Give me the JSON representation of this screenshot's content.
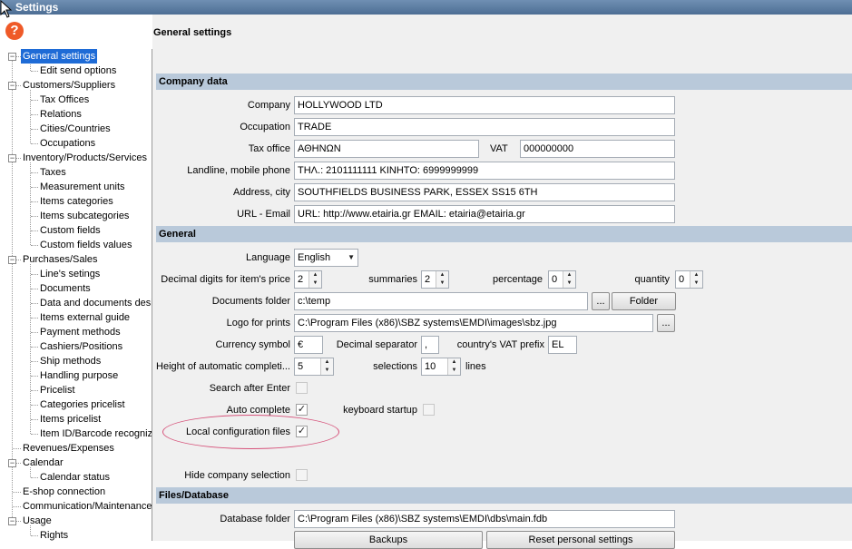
{
  "window": {
    "title": "Settings"
  },
  "help_glyph": "?",
  "tree": [
    {
      "label": "General settings",
      "selected": true
    },
    {
      "label": "Edit send options"
    },
    {
      "label": "Customers/Suppliers"
    },
    {
      "label": "Tax Offices"
    },
    {
      "label": "Relations"
    },
    {
      "label": "Cities/Countries"
    },
    {
      "label": "Occupations"
    },
    {
      "label": "Inventory/Products/Services"
    },
    {
      "label": "Taxes"
    },
    {
      "label": "Measurement units"
    },
    {
      "label": "Items categories"
    },
    {
      "label": "Items subcategories"
    },
    {
      "label": "Custom fields"
    },
    {
      "label": "Custom fields values"
    },
    {
      "label": "Purchases/Sales"
    },
    {
      "label": "Line's setings"
    },
    {
      "label": "Documents"
    },
    {
      "label": "Data and documents desi"
    },
    {
      "label": "Items external guide"
    },
    {
      "label": "Payment methods"
    },
    {
      "label": "Cashiers/Positions"
    },
    {
      "label": "Ship methods"
    },
    {
      "label": "Handling purpose"
    },
    {
      "label": "Pricelist"
    },
    {
      "label": "Categories pricelist"
    },
    {
      "label": "Items pricelist"
    },
    {
      "label": "Item ID/Barcode recognize"
    },
    {
      "label": "Revenues/Expenses"
    },
    {
      "label": "Calendar"
    },
    {
      "label": "Calendar status"
    },
    {
      "label": "E-shop connection"
    },
    {
      "label": "Communication/Maintenance"
    },
    {
      "label": "Usage"
    },
    {
      "label": "Rights"
    }
  ],
  "page_title": "General settings",
  "company": {
    "section_title": "Company data",
    "company_label": "Company",
    "company_value": "HOLLYWOOD LTD",
    "occupation_label": "Occupation",
    "occupation_value": "TRADE",
    "taxoffice_label": "Tax office",
    "taxoffice_value": "ΑΘΗΝΩΝ",
    "vat_label": "VAT",
    "vat_value": "000000000",
    "phone_label": "Landline, mobile phone",
    "phone_value": "ΤΗΛ.: 2101111111 ΚΙΝΗΤΟ: 6999999999",
    "address_label": "Address, city",
    "address_value": "SOUTHFIELDS BUSINESS PARK, ESSEX SS15 6TH",
    "url_label": "URL - Email",
    "url_value": "URL: http://www.etairia.gr EMAIL: etairia@etairia.gr"
  },
  "general": {
    "section_title": "General",
    "language_label": "Language",
    "language_value": "English",
    "decimal_label": "Decimal digits for item's price",
    "decimal_value": "2",
    "summaries_label": "summaries",
    "summaries_value": "2",
    "percentage_label": "percentage",
    "percentage_value": "0",
    "quantity_label": "quantity",
    "quantity_value": "0",
    "docfolder_label": "Documents folder",
    "docfolder_value": "c:\\temp",
    "ellipsis": "...",
    "folder_button": "Folder",
    "logo_label": "Logo for prints",
    "logo_value": "C:\\Program Files (x86)\\SBZ systems\\EMDI\\images\\sbz.jpg",
    "currency_label": "Currency symbol",
    "currency_value": "€",
    "decsep_label": "Decimal separator",
    "decsep_value": ",",
    "vatprefix_label": "country's VAT prefix",
    "vatprefix_value": "EL",
    "height_label": "Height of automatic completi...",
    "height_value": "5",
    "selections_label": "selections",
    "selections_value": "10",
    "lines_label": "lines",
    "search_label": "Search after Enter",
    "search_checked": false,
    "autocomplete_label": "Auto complete",
    "autocomplete_checked": true,
    "kbd_label": "keyboard startup",
    "kbd_checked": false,
    "localcfg_label": "Local configuration files",
    "localcfg_checked": true,
    "hide_label": "Hide company selection",
    "hide_checked": false
  },
  "files": {
    "section_title": "Files/Database",
    "db_label": "Database folder",
    "db_value": "C:\\Program Files (x86)\\SBZ systems\\EMDI\\dbs\\main.fdb",
    "backup_button": "Backups",
    "reset_button": "Reset personal settings"
  },
  "colors": {
    "section_bg": "#b9c9da",
    "tree_selected": "#1e6bd6",
    "highlight_oval": "#d6527a",
    "help_icon": "#ef5a28"
  }
}
